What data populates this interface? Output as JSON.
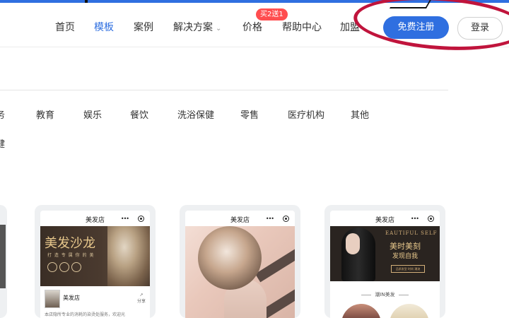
{
  "nav": {
    "items": [
      {
        "label": "首页",
        "active": false
      },
      {
        "label": "模板",
        "active": true
      },
      {
        "label": "案例",
        "active": false
      },
      {
        "label": "解决方案",
        "active": false,
        "dropdown": true
      },
      {
        "label": "价格",
        "active": false
      },
      {
        "label": "帮助中心",
        "active": false
      },
      {
        "label": "加盟",
        "active": false
      }
    ],
    "promo_badge": "买2送1",
    "chevron_icon": "chevron-down-icon"
  },
  "auth": {
    "register_label": "免费注册",
    "login_label": "登录"
  },
  "colors": {
    "accent": "#2f6fe0",
    "promo": "#ff4d4f",
    "annotation": "#c0143c"
  },
  "categories": {
    "cut_first": "务",
    "items": [
      "教育",
      "娱乐",
      "餐饮",
      "洗浴保健",
      "零售",
      "医疗机构",
      "其他"
    ],
    "cut_second": "健"
  },
  "templates": [
    {
      "phone_title": "美发店",
      "banner_title": "美发沙龙",
      "banner_sub": "打 造 专 属 你 的 美",
      "shop_name": "美发店",
      "share_label": "分享",
      "desc": "本店隐所专业的消耗的染烫处服务，欢迎光"
    },
    {
      "phone_title": "美发店"
    },
    {
      "phone_title": "美发店",
      "banner_script": "EAUTIFUL SELF",
      "banner_cn1": "美时美刻",
      "banner_cn2": "发现自我",
      "banner_box": "品质发型 时尚 潮流",
      "section_label": "潮IN美发"
    }
  ]
}
